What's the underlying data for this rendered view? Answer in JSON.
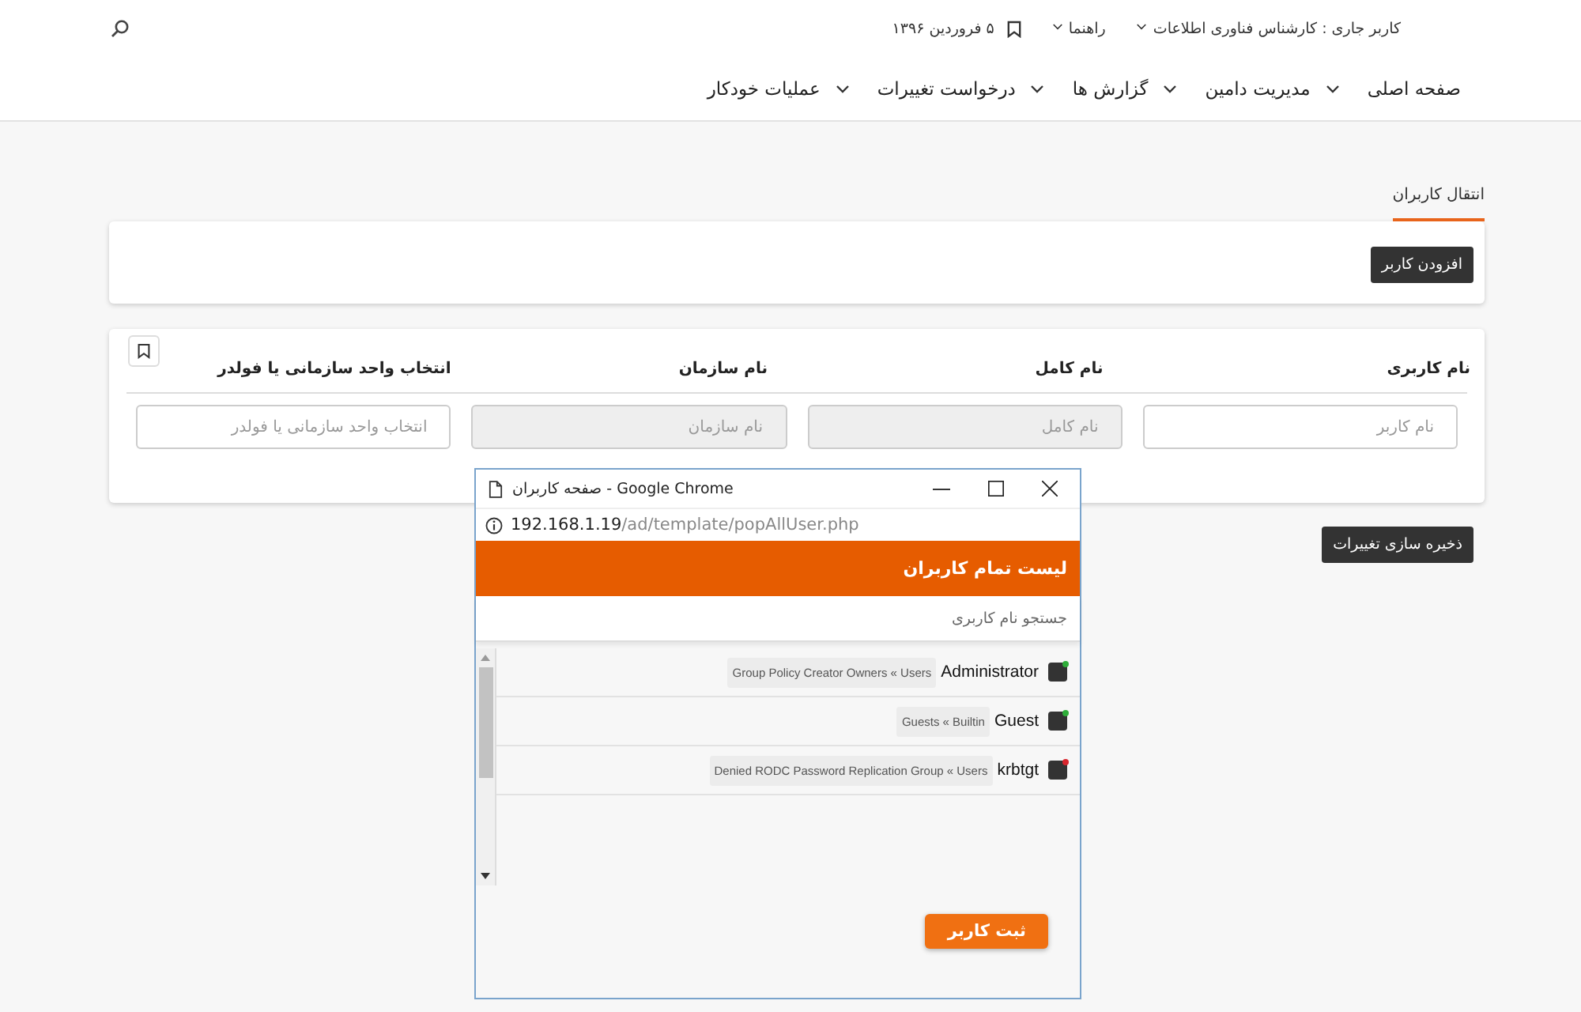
{
  "header": {
    "user_menu": "کاربر جاری : کارشناس فناوری اطلاعات",
    "help_menu": "راهنما",
    "date": "۵ فروردین ۱۳۹۶"
  },
  "nav": [
    {
      "label": "صفحه اصلی",
      "has_menu": false
    },
    {
      "label": "مدیریت دامین",
      "has_menu": true
    },
    {
      "label": "گزارش ها",
      "has_menu": true
    },
    {
      "label": "درخواست تغییرات",
      "has_menu": true
    },
    {
      "label": "عملیات خودکار",
      "has_menu": true
    }
  ],
  "tabs": [
    {
      "label": "انتقال کاربران",
      "selected": true
    }
  ],
  "add_button": "افزودن کاربر",
  "form": {
    "columns": [
      {
        "header": "نام کاربری",
        "placeholder": "نام کاربر",
        "disabled": false
      },
      {
        "header": "نام کامل",
        "placeholder": "نام کامل",
        "disabled": true
      },
      {
        "header": "نام سازمان",
        "placeholder": "نام سازمان",
        "disabled": true
      },
      {
        "header": "انتخاب واحد سازمانی یا فولدر",
        "placeholder": "انتخاب واحد سازمانی یا فولدر",
        "disabled": false
      }
    ]
  },
  "save_button": "ذخیره سازی تغییرات",
  "popup": {
    "title": "صفحه کاربران - Google Chrome",
    "url_host": "192.168.1.19",
    "url_path": "/ad/template/popAllUser.php",
    "heading": "لیست تمام کاربران",
    "search": {
      "placeholder": "جستجو نام کاربری"
    },
    "users": [
      {
        "name": "Administrator",
        "group": "Group Policy Creator Owners « Users",
        "color": "#2fae3a"
      },
      {
        "name": "Guest",
        "group": "Guests « Builtin",
        "color": "#2fae3a"
      },
      {
        "name": "krbtgt",
        "group": "Denied RODC Password Replication Group « Users",
        "color": "#d8262e"
      }
    ],
    "submit_button": "ثبت کاربر"
  }
}
